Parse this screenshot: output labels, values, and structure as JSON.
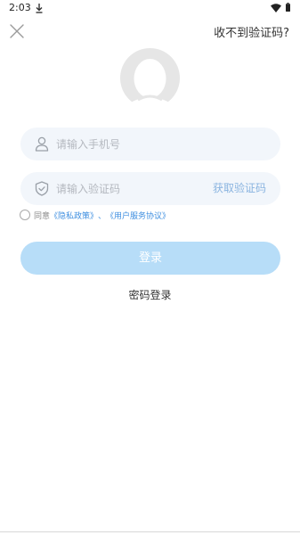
{
  "status_bar": {
    "time": "2:03"
  },
  "header": {
    "close_icon": "close-icon",
    "no_code_label": "收不到验证码?"
  },
  "avatar": {
    "icon": "user-avatar-icon"
  },
  "phone": {
    "placeholder": "请输入手机号",
    "value": ""
  },
  "code": {
    "placeholder": "请输入验证码",
    "value": "",
    "get_code_label": "获取验证码"
  },
  "agreement": {
    "prefix": "同意",
    "privacy_link": "《隐私政策》",
    "separator": "、",
    "terms_link": "《用户服务协议》",
    "checked": false
  },
  "login_button": {
    "label": "登录"
  },
  "password_login": {
    "label": "密码登录"
  },
  "colors": {
    "accent_link": "#3f8fe0",
    "button_disabled": "#b7ddf8",
    "input_bg": "#f2f6fb"
  }
}
